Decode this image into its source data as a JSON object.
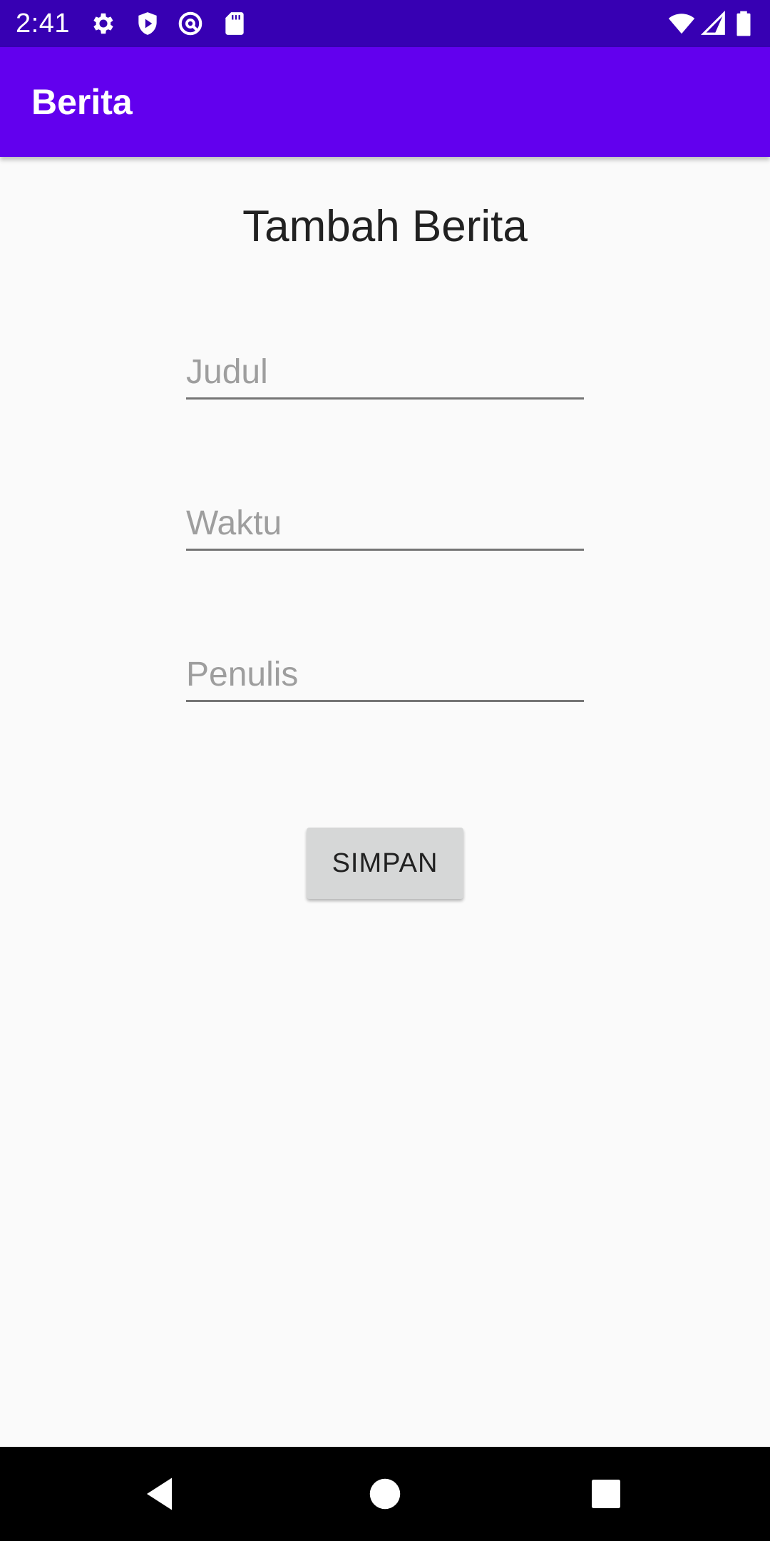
{
  "status_bar": {
    "time": "2:41",
    "icons": [
      "gear-icon",
      "shield-icon",
      "vpn-key-icon",
      "sd-card-icon",
      "wifi-icon",
      "cell-signal-icon",
      "battery-icon"
    ]
  },
  "app_bar": {
    "title": "Berita"
  },
  "form": {
    "title": "Tambah Berita",
    "judul_placeholder": "Judul",
    "waktu_placeholder": "Waktu",
    "penulis_placeholder": "Penulis",
    "save_label": "SIMPAN"
  },
  "nav_bar": {
    "icons": [
      "back-icon",
      "home-icon",
      "recents-icon"
    ]
  },
  "colors": {
    "status_bar": "#3700b3",
    "app_bar": "#6200ee",
    "background": "#fafafa",
    "button": "#d6d7d7"
  }
}
